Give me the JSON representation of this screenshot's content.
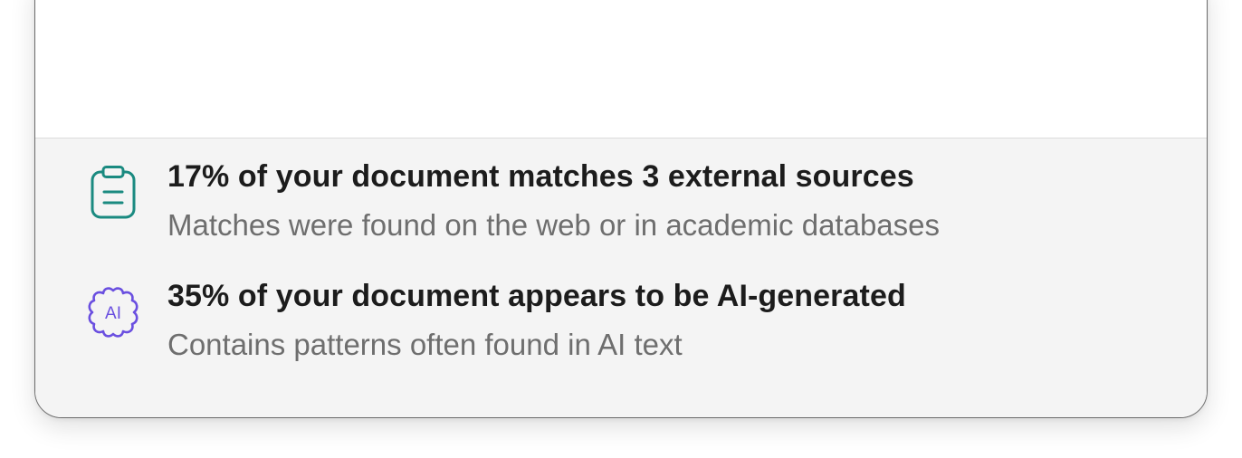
{
  "colors": {
    "plagiarism_icon": "#1a8a80",
    "ai_icon": "#6a4fe0",
    "headline": "#1c1c1c",
    "subtext": "#6e6e6e",
    "footer_bg": "#f4f4f4"
  },
  "results": {
    "plagiarism": {
      "icon": "clipboard-icon",
      "headline": "17% of your document matches 3 external sources",
      "subtext": "Matches were found on the web or in academic databases"
    },
    "ai_detection": {
      "icon": "ai-badge-icon",
      "icon_label": "AI",
      "headline": "35% of your document appears to be AI-generated",
      "subtext": "Contains patterns often found in AI text"
    }
  }
}
